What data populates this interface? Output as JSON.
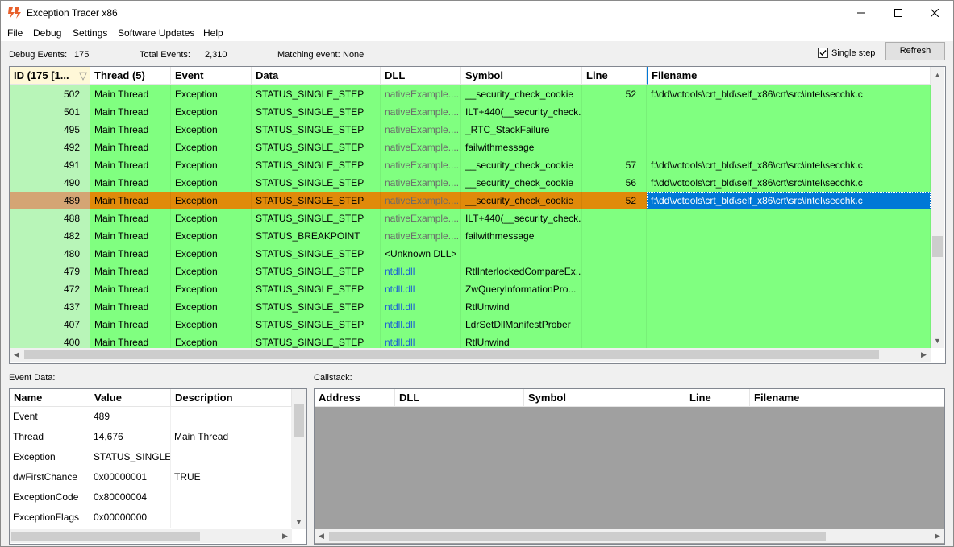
{
  "window": {
    "title": "Exception Tracer x86"
  },
  "menu": [
    "File",
    "Debug",
    "Settings",
    "Software Updates",
    "Help"
  ],
  "toolbar": {
    "debug_events_label": "Debug Events:",
    "debug_events_value": "175",
    "total_events_label": "Total Events:",
    "total_events_value": "2,310",
    "matching_event_label": "Matching event:",
    "matching_event_value": "None",
    "single_step_label": "Single step",
    "single_step_checked": true,
    "refresh_label": "Refresh"
  },
  "grid": {
    "columns": [
      "ID (175 [1...",
      "Thread (5)",
      "Event",
      "Data",
      "DLL",
      "Symbol",
      "Line",
      "Filename"
    ],
    "sort_indicator": "▽",
    "rows": [
      {
        "id": "502",
        "thread": "Main Thread",
        "event": "Exception",
        "data": "STATUS_SINGLE_STEP",
        "dll": "nativeExample....",
        "symbol": "__security_check_cookie",
        "line": "52",
        "filename": "f:\\dd\\vctools\\crt_bld\\self_x86\\crt\\src\\intel\\secchk.c"
      },
      {
        "id": "501",
        "thread": "Main Thread",
        "event": "Exception",
        "data": "STATUS_SINGLE_STEP",
        "dll": "nativeExample....",
        "symbol": "ILT+440(__security_check...",
        "line": "",
        "filename": ""
      },
      {
        "id": "495",
        "thread": "Main Thread",
        "event": "Exception",
        "data": "STATUS_SINGLE_STEP",
        "dll": "nativeExample....",
        "symbol": "_RTC_StackFailure",
        "line": "",
        "filename": ""
      },
      {
        "id": "492",
        "thread": "Main Thread",
        "event": "Exception",
        "data": "STATUS_SINGLE_STEP",
        "dll": "nativeExample....",
        "symbol": "failwithmessage",
        "line": "",
        "filename": ""
      },
      {
        "id": "491",
        "thread": "Main Thread",
        "event": "Exception",
        "data": "STATUS_SINGLE_STEP",
        "dll": "nativeExample....",
        "symbol": "__security_check_cookie",
        "line": "57",
        "filename": "f:\\dd\\vctools\\crt_bld\\self_x86\\crt\\src\\intel\\secchk.c"
      },
      {
        "id": "490",
        "thread": "Main Thread",
        "event": "Exception",
        "data": "STATUS_SINGLE_STEP",
        "dll": "nativeExample....",
        "symbol": "__security_check_cookie",
        "line": "56",
        "filename": "f:\\dd\\vctools\\crt_bld\\self_x86\\crt\\src\\intel\\secchk.c"
      },
      {
        "id": "489",
        "thread": "Main Thread",
        "event": "Exception",
        "data": "STATUS_SINGLE_STEP",
        "dll": "nativeExample....",
        "symbol": "__security_check_cookie",
        "line": "52",
        "filename": "f:\\dd\\vctools\\crt_bld\\self_x86\\crt\\src\\intel\\secchk.c"
      },
      {
        "id": "488",
        "thread": "Main Thread",
        "event": "Exception",
        "data": "STATUS_SINGLE_STEP",
        "dll": "nativeExample....",
        "symbol": "ILT+440(__security_check...",
        "line": "",
        "filename": ""
      },
      {
        "id": "482",
        "thread": "Main Thread",
        "event": "Exception",
        "data": "STATUS_BREAKPOINT",
        "dll": "nativeExample....",
        "symbol": "failwithmessage",
        "line": "",
        "filename": ""
      },
      {
        "id": "480",
        "thread": "Main Thread",
        "event": "Exception",
        "data": "STATUS_SINGLE_STEP",
        "dll": "<Unknown DLL>",
        "symbol": "",
        "line": "",
        "filename": ""
      },
      {
        "id": "479",
        "thread": "Main Thread",
        "event": "Exception",
        "data": "STATUS_SINGLE_STEP",
        "dll": "ntdll.dll",
        "symbol": "RtlInterlockedCompareEx...",
        "line": "",
        "filename": ""
      },
      {
        "id": "472",
        "thread": "Main Thread",
        "event": "Exception",
        "data": "STATUS_SINGLE_STEP",
        "dll": "ntdll.dll",
        "symbol": "ZwQueryInformationPro...",
        "line": "",
        "filename": ""
      },
      {
        "id": "437",
        "thread": "Main Thread",
        "event": "Exception",
        "data": "STATUS_SINGLE_STEP",
        "dll": "ntdll.dll",
        "symbol": "RtlUnwind",
        "line": "",
        "filename": ""
      },
      {
        "id": "407",
        "thread": "Main Thread",
        "event": "Exception",
        "data": "STATUS_SINGLE_STEP",
        "dll": "ntdll.dll",
        "symbol": "LdrSetDllManifestProber",
        "line": "",
        "filename": ""
      },
      {
        "id": "400",
        "thread": "Main Thread",
        "event": "Exception",
        "data": "STATUS_SINGLE_STEP",
        "dll": "ntdll.dll",
        "symbol": "RtlUnwind",
        "line": "",
        "filename": ""
      }
    ],
    "selected_id": "489"
  },
  "event_data": {
    "label": "Event Data:",
    "columns": [
      "Name",
      "Value",
      "Description"
    ],
    "rows": [
      {
        "name": "Event",
        "value": "489",
        "description": ""
      },
      {
        "name": "Thread",
        "value": "14,676",
        "description": "Main Thread"
      },
      {
        "name": "Exception",
        "value": "STATUS_SINGLE...",
        "description": ""
      },
      {
        "name": "dwFirstChance",
        "value": "0x00000001",
        "description": "TRUE"
      },
      {
        "name": "ExceptionCode",
        "value": "0x80000004",
        "description": ""
      },
      {
        "name": "ExceptionFlags",
        "value": "0x00000000",
        "description": ""
      }
    ]
  },
  "callstack": {
    "label": "Callstack:",
    "columns": [
      "Address",
      "DLL",
      "Symbol",
      "Line",
      "Filename"
    ]
  },
  "colors": {
    "row_green": "#80ff80",
    "id_green": "#b8f5b8",
    "selected_orange": "#e08a0a",
    "selected_id": "#d4a574",
    "selected_filename": "#0078d7"
  }
}
